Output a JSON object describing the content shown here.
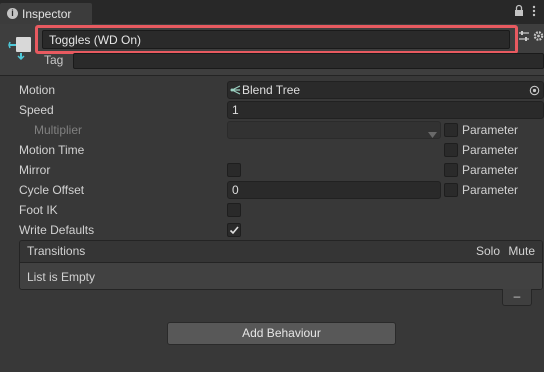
{
  "tab": {
    "title": "Inspector",
    "info_icon": "info-icon"
  },
  "header": {
    "state_name": "Toggles (WD On)",
    "tag_label": "Tag",
    "tag_value": "",
    "highlight_color": "#e85a60"
  },
  "fields": {
    "motion": {
      "label": "Motion",
      "value": "Blend Tree"
    },
    "speed": {
      "label": "Speed",
      "value": "1"
    },
    "multiplier": {
      "label": "Multiplier",
      "value": "",
      "param_label": "Parameter"
    },
    "motion_time": {
      "label": "Motion Time",
      "param_label": "Parameter"
    },
    "mirror": {
      "label": "Mirror",
      "param_label": "Parameter"
    },
    "cycle_offset": {
      "label": "Cycle Offset",
      "value": "0",
      "param_label": "Parameter"
    },
    "foot_ik": {
      "label": "Foot IK",
      "checked": false
    },
    "write_defaults": {
      "label": "Write Defaults",
      "checked": true
    }
  },
  "transitions": {
    "header": "Transitions",
    "solo": "Solo",
    "mute": "Mute",
    "empty": "List is Empty",
    "remove_label": "–"
  },
  "add_behaviour_label": "Add Behaviour"
}
